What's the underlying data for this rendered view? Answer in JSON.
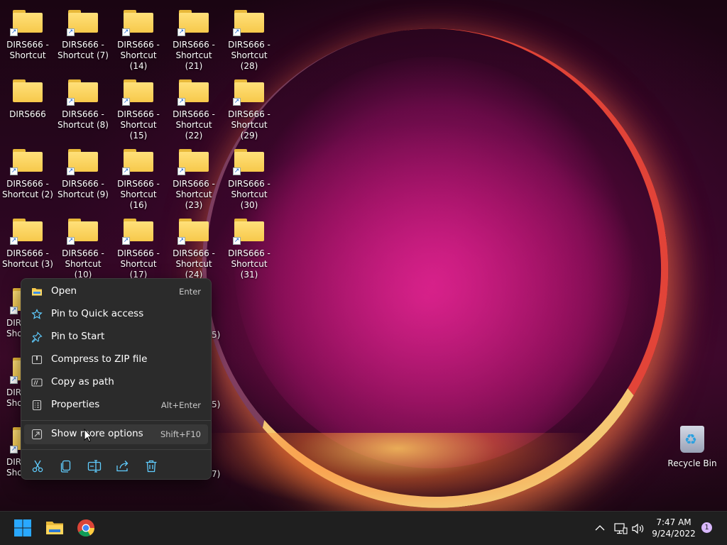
{
  "desktop": {
    "icons_col1": [
      {
        "label": "DIRS666 -\nShortcut",
        "shortcut": true
      },
      {
        "label": "DIRS666",
        "shortcut": false
      },
      {
        "label": "DIRS666 -\nShortcut (2)",
        "shortcut": true
      },
      {
        "label": "DIRS666 -\nShortcut (3)",
        "shortcut": true
      },
      {
        "label": "DIR\nShor",
        "shortcut": true
      },
      {
        "label": "DIR\nShor",
        "shortcut": true
      },
      {
        "label": "DIR\nShor",
        "shortcut": true
      }
    ],
    "icons_col2": [
      {
        "label": "DIRS666 -\nShortcut (7)",
        "shortcut": true
      },
      {
        "label": "DIRS666 -\nShortcut (8)",
        "shortcut": true
      },
      {
        "label": "DIRS666 -\nShortcut (9)",
        "shortcut": true
      },
      {
        "label": "DIRS666 -\nShortcut (10)",
        "shortcut": true
      }
    ],
    "icons_col3": [
      {
        "label": "DIRS666 -\nShortcut (14)",
        "shortcut": true
      },
      {
        "label": "DIRS666 -\nShortcut (15)",
        "shortcut": true
      },
      {
        "label": "DIRS666 -\nShortcut (16)",
        "shortcut": true
      },
      {
        "label": "DIRS666 -\nShortcut (17)",
        "shortcut": true
      }
    ],
    "icons_col4": [
      {
        "label": "DIRS666 -\nShortcut (21)",
        "shortcut": true
      },
      {
        "label": "DIRS666 -\nShortcut (22)",
        "shortcut": true
      },
      {
        "label": "DIRS666 -\nShortcut (23)",
        "shortcut": true
      },
      {
        "label": "DIRS666 -\nShortcut (24)",
        "shortcut": true
      }
    ],
    "icons_col5": [
      {
        "label": "DIRS666 -\nShortcut (28)",
        "shortcut": true
      },
      {
        "label": "DIRS666 -\nShortcut (29)",
        "shortcut": true
      },
      {
        "label": "DIRS666 -\nShortcut (30)",
        "shortcut": true
      },
      {
        "label": "DIRS666 -\nShortcut (31)",
        "shortcut": true
      }
    ],
    "hidden_fragments": [
      "5)",
      "5)",
      "7)"
    ],
    "recycle_bin_label": "Recycle Bin"
  },
  "context_menu": {
    "items": [
      {
        "label": "Open",
        "shortcut": "Enter",
        "icon": "folder-icon"
      },
      {
        "label": "Pin to Quick access",
        "shortcut": "",
        "icon": "star-icon"
      },
      {
        "label": "Pin to Start",
        "shortcut": "",
        "icon": "pin-icon"
      },
      {
        "label": "Compress to ZIP file",
        "shortcut": "",
        "icon": "zip-icon"
      },
      {
        "label": "Copy as path",
        "shortcut": "",
        "icon": "path-icon"
      },
      {
        "label": "Properties",
        "shortcut": "Alt+Enter",
        "icon": "properties-icon"
      }
    ],
    "more": {
      "label": "Show more options",
      "shortcut": "Shift+F10",
      "icon": "more-options-icon"
    },
    "toolbar": [
      "cut-icon",
      "copy-icon",
      "rename-icon",
      "share-icon",
      "delete-icon"
    ]
  },
  "taskbar": {
    "pinned": [
      "windows-start-icon",
      "file-explorer-icon",
      "chrome-icon"
    ],
    "time": "7:47 AM",
    "date": "9/24/2022",
    "notification_count": "1"
  },
  "colors": {
    "menu_bg": "#2b2b2b",
    "accent": "#60cdff",
    "folder": "#f7c94b",
    "taskbar_bg": "#1f1f1f"
  }
}
